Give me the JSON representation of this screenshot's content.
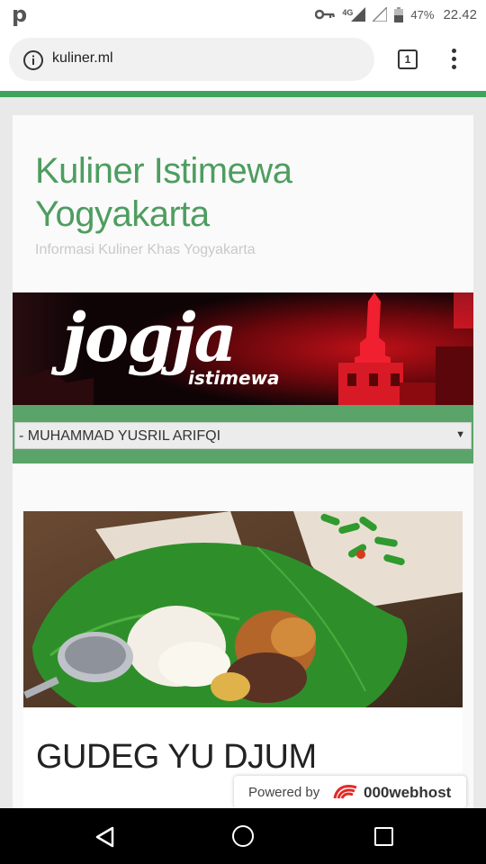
{
  "status_bar": {
    "app_letter": "p",
    "network": "4G",
    "battery": "47%",
    "time": "22.42"
  },
  "browser": {
    "url": "kuliner.ml",
    "tab_count": "1"
  },
  "site": {
    "title": "Kuliner Istimewa Yogyakarta",
    "description": "Informasi Kuliner Khas Yogyakarta",
    "banner_title": "jogja",
    "banner_subtitle": "istimewa",
    "accent_color": "#4e9d5f"
  },
  "nav": {
    "selected": "- MUHAMMAD YUSRIL ARIFQI"
  },
  "post": {
    "title": "GUDEG YU DJUM"
  },
  "footer_badge": {
    "powered_by": "Powered by",
    "host": "000webhost"
  }
}
